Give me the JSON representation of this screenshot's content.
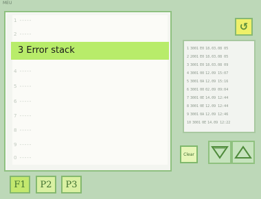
{
  "corner_tag": "MEU",
  "menu": {
    "items": [
      {
        "label": "1 -----"
      },
      {
        "label": "2 -----"
      },
      {
        "label": "3 Error stack"
      },
      {
        "label": "4 -----"
      },
      {
        "label": "5 -----"
      },
      {
        "label": "6 -----"
      },
      {
        "label": "7 -----"
      },
      {
        "label": "8 -----"
      },
      {
        "label": "9 -----"
      },
      {
        "label": "0 -----"
      }
    ],
    "selected_index": 2
  },
  "back_button": {
    "icon": "return-arrow-icon",
    "glyph": "↺"
  },
  "error_log": {
    "rows": [
      {
        "no": "1",
        "code": "3001",
        "id": "E0",
        "stamp": "18.03.08 05"
      },
      {
        "no": "2",
        "code": "2001",
        "id": "E0",
        "stamp": "18.03.08 05"
      },
      {
        "no": "3",
        "code": "3001",
        "id": "E0",
        "stamp": "18.03.08 09"
      },
      {
        "no": "4",
        "code": "3001",
        "id": "00",
        "stamp": "12.09 15:07"
      },
      {
        "no": "5",
        "code": "3001",
        "id": "0A",
        "stamp": "12.09 15:16"
      },
      {
        "no": "6",
        "code": "3001",
        "id": "00",
        "stamp": "02.09 09:04"
      },
      {
        "no": "7",
        "code": "3001",
        "id": "0E",
        "stamp": "14.09 12:44"
      },
      {
        "no": "8",
        "code": "3001",
        "id": "0E",
        "stamp": "12.09 12:44"
      },
      {
        "no": "9",
        "code": "3001",
        "id": "0A",
        "stamp": "12.09 12:46"
      },
      {
        "no": "10",
        "code": "3001",
        "id": "0E",
        "stamp": "14.09 12:22"
      }
    ]
  },
  "controls": {
    "clear_label": "Clear",
    "up_icon": "triangle-up-icon",
    "down_icon": "triangle-down-icon"
  },
  "function_tabs": [
    {
      "label": "F1"
    },
    {
      "label": "P2"
    },
    {
      "label": "P3"
    }
  ]
}
